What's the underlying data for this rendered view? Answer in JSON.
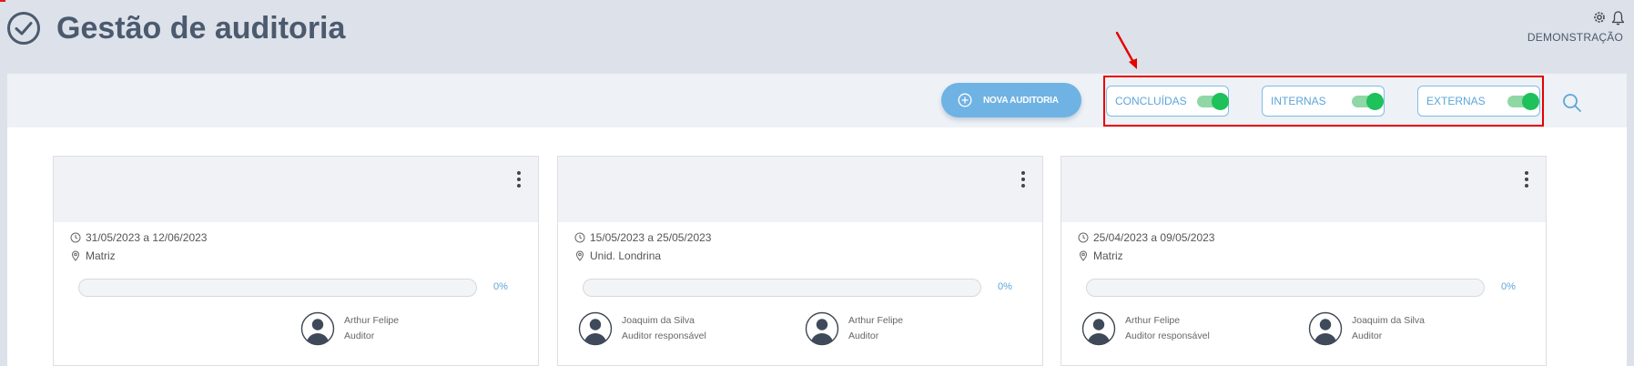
{
  "header": {
    "title": "Gestão de auditoria",
    "org_name": "DEMONSTRAÇÃO"
  },
  "toolbar": {
    "new_button_label": "NOVA AUDITORIA",
    "filters": [
      {
        "label": "CONCLUÍDAS",
        "enabled": true
      },
      {
        "label": "INTERNAS",
        "enabled": true
      },
      {
        "label": "EXTERNAS",
        "enabled": true
      }
    ]
  },
  "colors": {
    "accent": "#6fb2e4",
    "toggle_on": "#1ec15a",
    "highlight": "#e60000",
    "title": "#4b5a6e"
  },
  "audits": [
    {
      "period": "31/05/2023 a 12/06/2023",
      "unit": "Matriz",
      "progress": "0%",
      "people": [
        {
          "name": "Arthur Felipe",
          "role": "Auditor"
        }
      ]
    },
    {
      "period": "15/05/2023 a 25/05/2023",
      "unit": "Unid. Londrina",
      "progress": "0%",
      "people": [
        {
          "name": "Joaquim da Silva",
          "role": "Auditor responsável"
        },
        {
          "name": "Arthur Felipe",
          "role": "Auditor"
        }
      ]
    },
    {
      "period": "25/04/2023 a 09/05/2023",
      "unit": "Matriz",
      "progress": "0%",
      "people": [
        {
          "name": "Arthur Felipe",
          "role": "Auditor responsável"
        },
        {
          "name": "Joaquim da Silva",
          "role": "Auditor"
        }
      ]
    }
  ]
}
